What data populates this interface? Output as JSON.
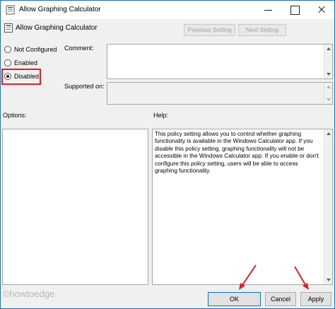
{
  "window": {
    "title": "Allow Graphing Calculator"
  },
  "header": {
    "policy_name": "Allow Graphing Calculator",
    "previous_setting_label": "Previous Setting",
    "next_setting_label": "Next Setting"
  },
  "state": {
    "options": [
      {
        "label": "Not Configured",
        "selected": false
      },
      {
        "label": "Enabled",
        "selected": false
      },
      {
        "label": "Disabled",
        "selected": true
      }
    ]
  },
  "fields": {
    "comment_label": "Comment:",
    "supported_on_label": "Supported on:",
    "options_label": "Options:",
    "help_label": "Help:"
  },
  "help": {
    "text": "This policy setting allows you to control whether graphing functionality is available in the Windows Calculator app. If you disable this policy setting, graphing functionality will not be accessible in the Windows Calculator app. If you enable or don't configure this policy setting, users will be able to access graphing functionality."
  },
  "footer": {
    "ok_label": "OK",
    "cancel_label": "Cancel",
    "apply_label": "Apply",
    "watermark": "©howtoedge"
  },
  "colors": {
    "highlight": "#e01f24",
    "accent": "#0078d7"
  }
}
